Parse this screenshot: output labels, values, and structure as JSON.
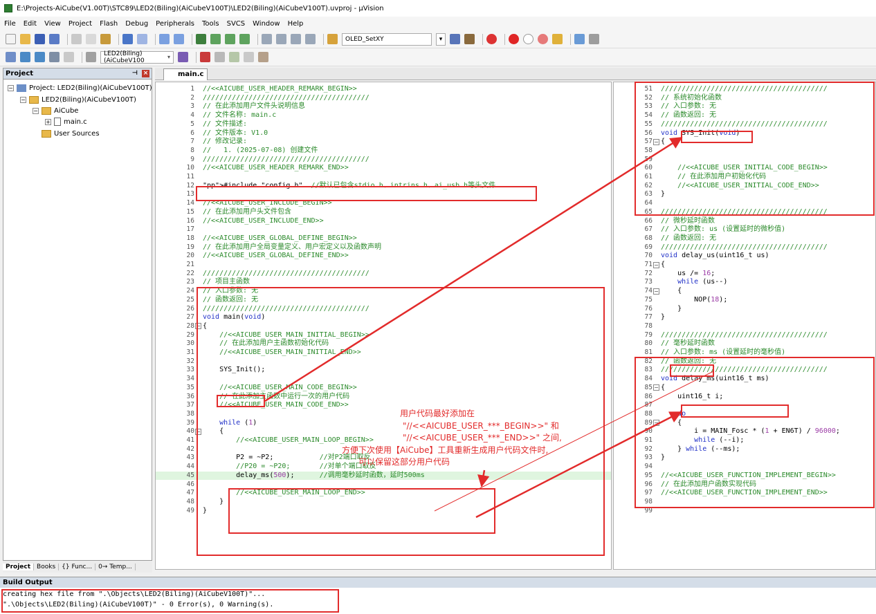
{
  "window": {
    "title": "E:\\Projects-AiCube(V1.00T)\\STC89\\LED2(Biling)(AiCubeV100T)\\LED2(Biling)(AiCubeV100T).uvproj - µVision"
  },
  "menu": [
    "File",
    "Edit",
    "View",
    "Project",
    "Flash",
    "Debug",
    "Peripherals",
    "Tools",
    "SVCS",
    "Window",
    "Help"
  ],
  "toolbar": {
    "find_combo": "OLED_SetXY",
    "target_combo": "LED2(Biling)(AiCubeV100"
  },
  "project_panel": {
    "title": "Project",
    "tree": [
      {
        "label": "Project: LED2(Biling)(AiCubeV100T)",
        "expander": "−"
      },
      {
        "label": "LED2(Biling)(AiCubeV100T)",
        "expander": "−"
      },
      {
        "label": "AiCube",
        "expander": "−"
      },
      {
        "label": "main.c",
        "expander": "+"
      },
      {
        "label": "User Sources",
        "expander": ""
      }
    ],
    "tabs": [
      "Project",
      "Books",
      "{} Func...",
      "0→ Temp..."
    ]
  },
  "editor": {
    "active_tab": "main.c",
    "left_pane": [
      {
        "n": "1",
        "t": "//<<AICUBE_USER_HEADER_REMARK_BEGIN>>",
        "c": "cmt"
      },
      {
        "n": "2",
        "t": "////////////////////////////////////////",
        "c": "cmt"
      },
      {
        "n": "3",
        "t": "// 在此添加用户文件头说明信息",
        "c": "cmt"
      },
      {
        "n": "4",
        "t": "// 文件名称: main.c",
        "c": "cmt"
      },
      {
        "n": "5",
        "t": "// 文件描述:",
        "c": "cmt"
      },
      {
        "n": "6",
        "t": "// 文件版本: V1.0",
        "c": "cmt"
      },
      {
        "n": "7",
        "t": "// 修改记录:",
        "c": "cmt"
      },
      {
        "n": "8",
        "t": "//   1. (2025-07-08) 创建文件",
        "c": "cmt"
      },
      {
        "n": "9",
        "t": "////////////////////////////////////////",
        "c": "cmt"
      },
      {
        "n": "10",
        "t": "//<<AICUBE_USER_HEADER_REMARK_END>>",
        "c": "cmt"
      },
      {
        "n": "11",
        "t": "",
        "c": ""
      },
      {
        "n": "12",
        "t": "#include \"config.h\"  //默认已包含stdio.h、intrins.h、ai_usb.h等头文件",
        "c": "inc"
      },
      {
        "n": "13",
        "t": "",
        "c": ""
      },
      {
        "n": "14",
        "t": "//<<AICUBE_USER_INCLUDE_BEGIN>>",
        "c": "cmt"
      },
      {
        "n": "15",
        "t": "// 在此添加用户头文件包含",
        "c": "cmt"
      },
      {
        "n": "16",
        "t": "//<<AICUBE_USER_INCLUDE_END>>",
        "c": "cmt"
      },
      {
        "n": "17",
        "t": "",
        "c": ""
      },
      {
        "n": "18",
        "t": "//<<AICUBE_USER_GLOBAL_DEFINE_BEGIN>>",
        "c": "cmt"
      },
      {
        "n": "19",
        "t": "// 在此添加用户全局变量定义、用户宏定义以及函数声明",
        "c": "cmt"
      },
      {
        "n": "20",
        "t": "//<<AICUBE_USER_GLOBAL_DEFINE_END>>",
        "c": "cmt"
      },
      {
        "n": "21",
        "t": "",
        "c": ""
      },
      {
        "n": "22",
        "t": "////////////////////////////////////////",
        "c": "cmt"
      },
      {
        "n": "23",
        "t": "// 项目主函数",
        "c": "cmt"
      },
      {
        "n": "24",
        "t": "// 入口参数: 无",
        "c": "cmt"
      },
      {
        "n": "25",
        "t": "// 函数返回: 无",
        "c": "cmt"
      },
      {
        "n": "26",
        "t": "////////////////////////////////////////",
        "c": "cmt"
      },
      {
        "n": "27",
        "t": "void main(void)",
        "c": "fn"
      },
      {
        "n": "28",
        "t": "{",
        "c": ""
      },
      {
        "n": "29",
        "t": "    //<<AICUBE_USER_MAIN_INITIAL_BEGIN>>",
        "c": "cmt"
      },
      {
        "n": "30",
        "t": "    // 在此添加用户主函数初始化代码",
        "c": "cmt"
      },
      {
        "n": "31",
        "t": "    //<<AICUBE_USER_MAIN_INITIAL_END>>",
        "c": "cmt"
      },
      {
        "n": "32",
        "t": "",
        "c": ""
      },
      {
        "n": "33",
        "t": "    SYS_Init();",
        "c": ""
      },
      {
        "n": "34",
        "t": "",
        "c": ""
      },
      {
        "n": "35",
        "t": "    //<<AICUBE_USER_MAIN_CODE_BEGIN>>",
        "c": "cmt"
      },
      {
        "n": "36",
        "t": "    // 在此添加主函数中运行一次的用户代码",
        "c": "cmt"
      },
      {
        "n": "37",
        "t": "    //<<AICUBE_USER_MAIN_CODE_END>>",
        "c": "cmt"
      },
      {
        "n": "38",
        "t": "",
        "c": ""
      },
      {
        "n": "39",
        "t": "    while (1)",
        "c": "while"
      },
      {
        "n": "40",
        "t": "    {",
        "c": ""
      },
      {
        "n": "41",
        "t": "        //<<AICUBE_USER_MAIN_LOOP_BEGIN>>",
        "c": "cmt"
      },
      {
        "n": "42",
        "t": "",
        "c": ""
      },
      {
        "n": "43",
        "t": "        P2 = ~P2;           //对P2端口取反",
        "c": "stmt"
      },
      {
        "n": "44",
        "t": "        //P20 = ~P20;       //对单个端口取反",
        "c": "cmt"
      },
      {
        "n": "45",
        "t": "        delay_ms(500);      //调用毫秒延时函数，延时500ms",
        "c": "stmt"
      },
      {
        "n": "46",
        "t": "",
        "c": ""
      },
      {
        "n": "47",
        "t": "        //<<AICUBE_USER_MAIN_LOOP_END>>",
        "c": "cmt"
      },
      {
        "n": "48",
        "t": "    }",
        "c": ""
      },
      {
        "n": "49",
        "t": "}",
        "c": ""
      }
    ],
    "right_pane": [
      {
        "n": "51",
        "t": "////////////////////////////////////////",
        "c": "cmt"
      },
      {
        "n": "52",
        "t": "// 系统初始化函数",
        "c": "cmt"
      },
      {
        "n": "53",
        "t": "// 入口参数: 无",
        "c": "cmt"
      },
      {
        "n": "54",
        "t": "// 函数返回: 无",
        "c": "cmt"
      },
      {
        "n": "55",
        "t": "////////////////////////////////////////",
        "c": "cmt"
      },
      {
        "n": "56",
        "t": "void SYS_Init(void)",
        "c": "fn"
      },
      {
        "n": "57",
        "t": "{",
        "c": ""
      },
      {
        "n": "58",
        "t": "",
        "c": ""
      },
      {
        "n": "59",
        "t": "",
        "c": ""
      },
      {
        "n": "60",
        "t": "    //<<AICUBE_USER_INITIAL_CODE_BEGIN>>",
        "c": "cmt"
      },
      {
        "n": "61",
        "t": "    // 在此添加用户初始化代码",
        "c": "cmt"
      },
      {
        "n": "62",
        "t": "    //<<AICUBE_USER_INITIAL_CODE_END>>",
        "c": "cmt"
      },
      {
        "n": "63",
        "t": "}",
        "c": ""
      },
      {
        "n": "64",
        "t": "",
        "c": ""
      },
      {
        "n": "65",
        "t": "////////////////////////////////////////",
        "c": "cmt"
      },
      {
        "n": "66",
        "t": "// 微秒延时函数",
        "c": "cmt"
      },
      {
        "n": "67",
        "t": "// 入口参数: us (设置延时的微秒值)",
        "c": "cmt"
      },
      {
        "n": "68",
        "t": "// 函数返回: 无",
        "c": "cmt"
      },
      {
        "n": "69",
        "t": "////////////////////////////////////////",
        "c": "cmt"
      },
      {
        "n": "70",
        "t": "void delay_us(uint16_t us)",
        "c": "fn"
      },
      {
        "n": "71",
        "t": "{",
        "c": ""
      },
      {
        "n": "72",
        "t": "    us /= 16;",
        "c": "stmt"
      },
      {
        "n": "73",
        "t": "    while (us--)",
        "c": "while"
      },
      {
        "n": "74",
        "t": "    {",
        "c": ""
      },
      {
        "n": "75",
        "t": "        NOP(18);",
        "c": "stmt"
      },
      {
        "n": "76",
        "t": "    }",
        "c": ""
      },
      {
        "n": "77",
        "t": "}",
        "c": ""
      },
      {
        "n": "78",
        "t": "",
        "c": ""
      },
      {
        "n": "79",
        "t": "////////////////////////////////////////",
        "c": "cmt"
      },
      {
        "n": "80",
        "t": "// 毫秒延时函数",
        "c": "cmt"
      },
      {
        "n": "81",
        "t": "// 入口参数: ms (设置延时的毫秒值)",
        "c": "cmt"
      },
      {
        "n": "82",
        "t": "// 函数返回: 无",
        "c": "cmt"
      },
      {
        "n": "83",
        "t": "////////////////////////////////////////",
        "c": "cmt"
      },
      {
        "n": "84",
        "t": "void delay_ms(uint16_t ms)",
        "c": "fn"
      },
      {
        "n": "85",
        "t": "{",
        "c": ""
      },
      {
        "n": "86",
        "t": "    uint16_t i;",
        "c": ""
      },
      {
        "n": "87",
        "t": "",
        "c": ""
      },
      {
        "n": "88",
        "t": "    do",
        "c": "do"
      },
      {
        "n": "89",
        "t": "    {",
        "c": ""
      },
      {
        "n": "90",
        "t": "        i = MAIN_Fosc * (1 + EN6T) / 96000;",
        "c": "stmt"
      },
      {
        "n": "91",
        "t": "        while (--i);",
        "c": "while"
      },
      {
        "n": "92",
        "t": "    } while (--ms);",
        "c": "while"
      },
      {
        "n": "93",
        "t": "}",
        "c": ""
      },
      {
        "n": "94",
        "t": "",
        "c": ""
      },
      {
        "n": "95",
        "t": "//<<AICUBE_USER_FUNCTION_IMPLEMENT_BEGIN>>",
        "c": "cmt"
      },
      {
        "n": "96",
        "t": "// 在此添加用户函数实现代码",
        "c": "cmt"
      },
      {
        "n": "97",
        "t": "//<<AICUBE_USER_FUNCTION_IMPLEMENT_END>>",
        "c": "cmt"
      },
      {
        "n": "98",
        "t": "",
        "c": ""
      },
      {
        "n": "99",
        "t": "",
        "c": ""
      }
    ]
  },
  "annotation": [
    "用户代码最好添加在",
    "\"//<<AICUBE_USER_***_BEGIN>>\" 和",
    "\"//<<AICUBE_USER_***_END>>\" 之间,",
    "方便下次使用【AiCube】工具重新生成用户代码文件时,",
    "可以保留这部分用户代码"
  ],
  "build_output": {
    "title": "Build Output",
    "lines": [
      "creating hex file from \".\\Objects\\LED2(Biling)(AiCubeV100T)\"...",
      "\".\\Objects\\LED2(Biling)(AiCubeV100T)\" - 0 Error(s), 0 Warning(s)."
    ]
  },
  "colors": {
    "comment": "#2b8a2b",
    "keyword": "#1f2fc7",
    "number": "#9b3ba5",
    "annotation_red": "#e22b2b",
    "current_line": "#dff5df"
  }
}
